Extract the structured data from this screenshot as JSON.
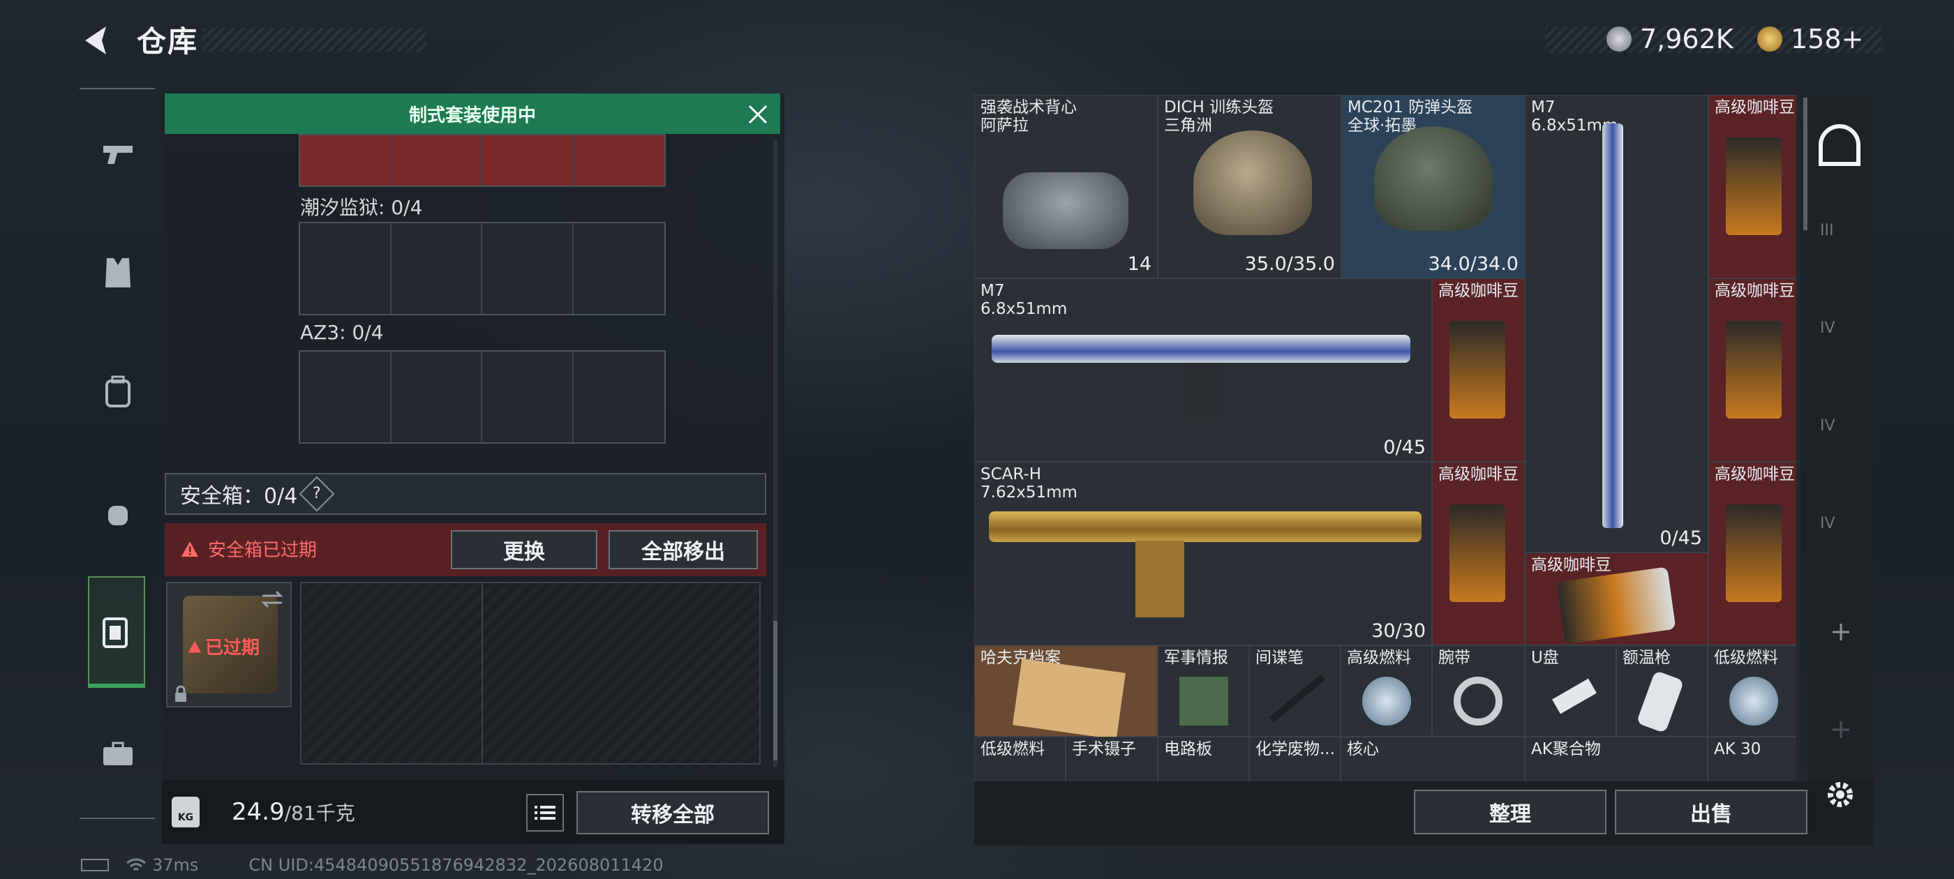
{
  "header": {
    "title": "仓库",
    "currency_silver": "7,962K",
    "currency_gold": "158+"
  },
  "left_panel": {
    "banner": "制式套装使用中",
    "slot1_label": "潮汐监狱: 0/4",
    "slot2_label": "AZ3: 0/4",
    "safe_box_label": "安全箱：0/4",
    "safe_box_help": "?",
    "expired_warning": "安全箱已过期",
    "replace_button": "更换",
    "remove_all_button": "全部移出",
    "case_expired": "已过期",
    "weight_value": "24.9",
    "weight_max": "/81千克",
    "weight_icon_text": "KG",
    "transfer_all_button": "转移全部"
  },
  "inventory": {
    "items": [
      {
        "name": "强袭战术背心\n阿萨拉",
        "count": "14",
        "type": "vest"
      },
      {
        "name": "DICH 训练头盔\n三角洲",
        "count": "35.0/35.0",
        "type": "helmet"
      },
      {
        "name": "MC201 防弹头盔\n全球·拓墨",
        "count": "34.0/34.0",
        "type": "helmet"
      },
      {
        "name": "M7\n6.8x51mm",
        "count": "0/45",
        "type": "rifle-vertical"
      },
      {
        "name": "高级咖啡豆",
        "count": "",
        "type": "coffee"
      },
      {
        "name": "M7\n6.8x51mm",
        "count": "0/45",
        "type": "rifle"
      },
      {
        "name": "高级咖啡豆",
        "count": "",
        "type": "coffee"
      },
      {
        "name": "高级咖啡豆",
        "count": "",
        "type": "coffee"
      },
      {
        "name": "SCAR-H\n7.62x51mm",
        "count": "30/30",
        "type": "rifle-gold"
      },
      {
        "name": "高级咖啡豆",
        "count": "",
        "type": "coffee"
      },
      {
        "name": "高级咖啡豆",
        "count": "",
        "type": "coffee"
      },
      {
        "name": "高级咖啡豆",
        "count": "",
        "type": "coffee"
      },
      {
        "name": "哈夫克档案",
        "count": "",
        "type": "file"
      },
      {
        "name": "军事情报",
        "count": "",
        "type": "board"
      },
      {
        "name": "间谍笔",
        "count": "",
        "type": "pen"
      },
      {
        "name": "高级燃料",
        "count": "",
        "type": "fuel"
      },
      {
        "name": "腕带",
        "count": "",
        "type": "band"
      },
      {
        "name": "U盘",
        "count": "",
        "type": "usb"
      },
      {
        "name": "额温枪",
        "count": "",
        "type": "thermo"
      },
      {
        "name": "低级燃料",
        "count": "",
        "type": "fuel"
      },
      {
        "name": "低级燃料",
        "count": "",
        "type": "fuel"
      },
      {
        "name": "手术镊子",
        "count": "",
        "type": "tool"
      },
      {
        "name": "电路板",
        "count": "",
        "type": "board"
      },
      {
        "name": "化学废物...",
        "count": "",
        "type": "misc"
      },
      {
        "name": "核心",
        "count": "",
        "type": "misc"
      },
      {
        "name": "AK聚合物",
        "count": "",
        "type": "misc"
      },
      {
        "name": "AK 30",
        "count": "",
        "type": "misc"
      }
    ],
    "sort_button": "整理",
    "sell_button": "出售"
  },
  "right_rail": {
    "tabs": [
      "III",
      "IV",
      "IV",
      "IV"
    ]
  },
  "status_bar": {
    "ping": "37ms",
    "uid": "CN UID:4548409055187694283​2_202608011420"
  },
  "colors": {
    "accent_green": "#1e7a52",
    "warning_red": "#ff6b6b",
    "coffee_bg": "#5a2326"
  }
}
